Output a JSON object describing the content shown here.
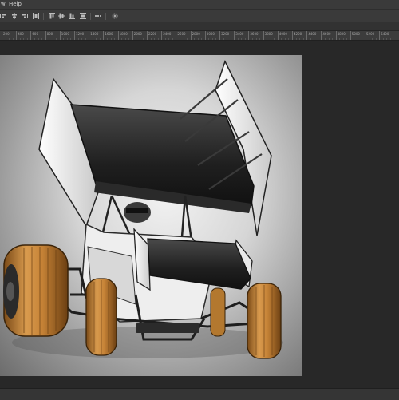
{
  "menu": {
    "partial_item": "w",
    "help": "Help"
  },
  "toolbar": {
    "icons": [
      "align-left-edges-icon",
      "align-horizontal-centers-icon",
      "align-right-edges-icon",
      "distribute-icon",
      "align-top-edges-icon",
      "align-vertical-centers-icon",
      "align-bottom-edges-icon",
      "more-options-icon",
      "settings-gear-icon"
    ]
  },
  "ruler": {
    "labels": [
      "200",
      "400",
      "600",
      "800",
      "1000",
      "1200",
      "1400",
      "1600",
      "1800",
      "2000",
      "2200",
      "2400",
      "2600",
      "2800",
      "3000",
      "3200",
      "3400",
      "3600",
      "3800",
      "4000",
      "4200",
      "4400",
      "4600",
      "4800",
      "5000",
      "5200",
      "5400"
    ]
  },
  "canvas": {
    "image": "sprint-car-render",
    "colors": {
      "wing": "#2f2f2f",
      "body": "#f2f2f2",
      "tire": "#c98a3c",
      "frame": "#2a2a2a"
    }
  }
}
